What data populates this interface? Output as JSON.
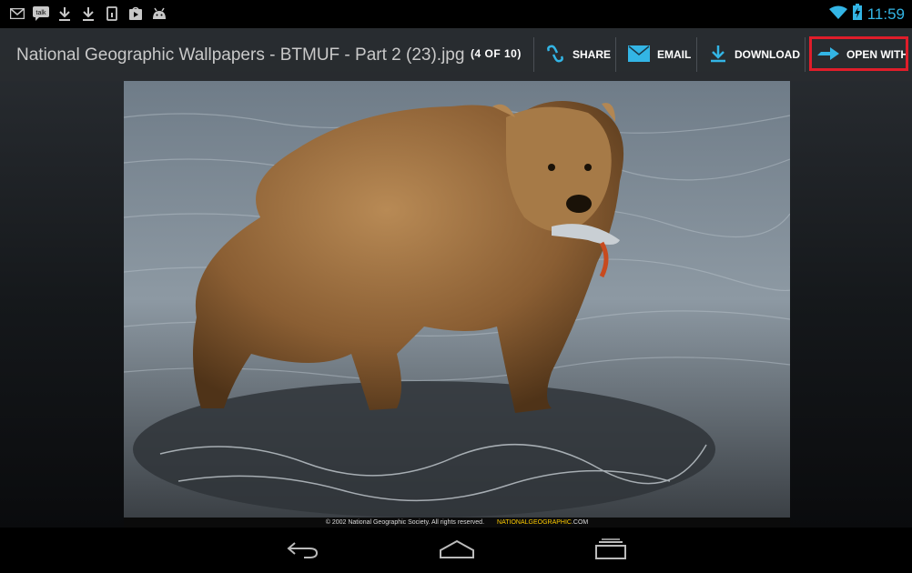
{
  "status_bar": {
    "icons": [
      "gmail-icon",
      "talk-icon",
      "download-icon",
      "download-icon",
      "sim-icon",
      "play-store-icon",
      "android-icon"
    ],
    "talk_label": "talk",
    "time": "11:59"
  },
  "action_bar": {
    "file_name": "National Geographic Wallpapers - BTMUF - Part 2 (23).jpg",
    "counter": "(4 OF 10)",
    "share_label": "SHARE",
    "email_label": "EMAIL",
    "download_label": "DOWNLOAD",
    "open_with_label": "OPEN WITH"
  },
  "photo": {
    "credit": "© 2002 National Geographic Society. All rights reserved.",
    "brand": "NATIONALGEOGRAPHIC",
    "brand_suffix": ".COM"
  },
  "nav_bar": {
    "icons": [
      "back-icon",
      "home-icon",
      "recent-apps-icon"
    ]
  },
  "colors": {
    "accent": "#33b5e5",
    "highlight": "#e01d2a"
  }
}
